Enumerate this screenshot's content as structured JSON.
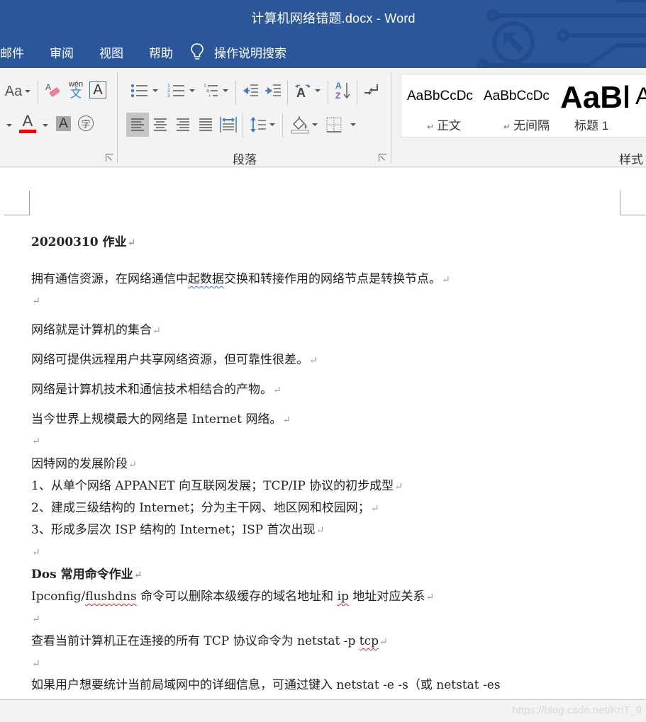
{
  "window": {
    "title": "计算机网络错题.docx  -  Word",
    "theme_color": "#2b579a"
  },
  "tabs": [
    {
      "label": "邮件"
    },
    {
      "label": "审阅"
    },
    {
      "label": "视图"
    },
    {
      "label": "帮助"
    }
  ],
  "tell_me": {
    "label": "操作说明搜索",
    "icon": "lightbulb-icon"
  },
  "ribbon": {
    "font_group": {
      "change_case_label": "Aa",
      "phonetic_guide_label_top": "wén",
      "phonetic_guide_label_bottom": "文",
      "char_border_label": "A",
      "font_color_label": "A",
      "font_color": "#ff0000",
      "char_shading_label": "A",
      "enclose_char_label": "字"
    },
    "paragraph_group": {
      "label": "段落",
      "active_alignment": "left"
    },
    "styles_group": {
      "label": "样式",
      "items": [
        {
          "sample": "AaBbCcDc",
          "name": "正文",
          "paragraph_mark": "↵"
        },
        {
          "sample": "AaBbCcDc",
          "name": "无间隔",
          "paragraph_mark": "↵"
        },
        {
          "sample": "AaBl",
          "name": "标题 1"
        },
        {
          "sample": "A",
          "name": ""
        }
      ]
    }
  },
  "document": {
    "paragraph_mark": "↵",
    "paragraphs": [
      {
        "text": "20200310 作业",
        "bold": true
      },
      {
        "pre": "拥有通信资源，在网络通信中",
        "flag": "起数据",
        "post": "交换和转接作用的网络节点是转换节点。"
      },
      {
        "text": ""
      },
      {
        "text": "网络就是计算机的集合"
      },
      {
        "text": "网络可提供远程用户共享网络资源，但可靠性很差。"
      },
      {
        "text": "网络是计算机技术和通信技术相结合的产物。"
      },
      {
        "text": "当今世界上规模最大的网络是 Internet 网络。"
      },
      {
        "text": ""
      },
      {
        "text": "因特网的发展阶段"
      },
      {
        "text": "1、从单个网络 APPANET 向互联网发展；TCP/IP 协议的初步成型"
      },
      {
        "text": "2、建成三级结构的 Internet；分为主干网、地区网和校园网；"
      },
      {
        "text": "3、形成多层次 ISP 结构的 Internet；ISP 首次出现"
      },
      {
        "text": ""
      },
      {
        "text": "Dos 常用命令作业",
        "bold": true
      },
      {
        "pre": "Ipconfig/",
        "flag": "flushdns",
        "mid": " 命令可以删除本级缓存的域名地址和 ",
        "flag2": "ip",
        "post": " 地址对应关系"
      },
      {
        "text": ""
      },
      {
        "pre": "查看当前计算机正在连接的所有 TCP 协议命令为 netstat -p ",
        "flag": "tcp",
        "post": ""
      },
      {
        "text": ""
      },
      {
        "text": "如果用户想要统计当前局域网中的详细信息，可通过键入 netstat -e -s（或 netstat -es"
      }
    ]
  },
  "statusbar": {
    "watermark": "https://blog.csdn.net/KnT_9"
  }
}
